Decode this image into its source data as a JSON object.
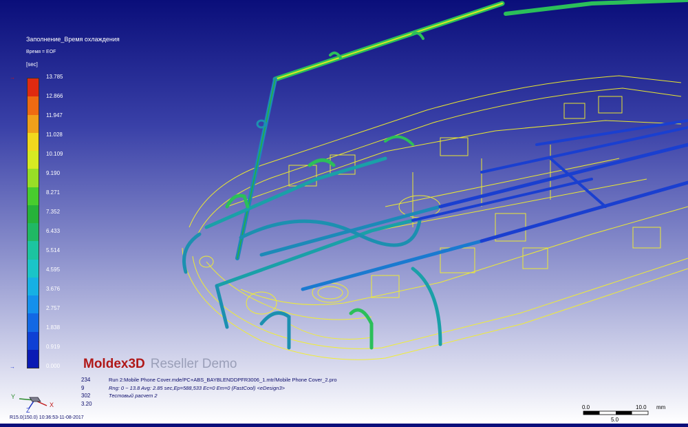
{
  "legend": {
    "title": "Заполнение_Время охлаждения",
    "time_label": "Время = EOF",
    "unit": "[sec]",
    "ticks": [
      "13.785",
      "12.866",
      "11.947",
      "11.028",
      "10.109",
      "9.190",
      "8.271",
      "7.352",
      "6.433",
      "5.514",
      "4.595",
      "3.676",
      "2.757",
      "1.838",
      "0.919",
      "0.000"
    ],
    "colors": [
      "#e02a10",
      "#ee6a12",
      "#f0a01a",
      "#f2d81e",
      "#d6ea22",
      "#98de26",
      "#48cc2e",
      "#26b23a",
      "#20b864",
      "#1cc4a0",
      "#1ac4c8",
      "#16b0e4",
      "#1490ec",
      "#1268e4",
      "#0e40d4",
      "#0a1ab4"
    ]
  },
  "brand": {
    "logo": "Moldex3D",
    "suffix": "Reseller Demo"
  },
  "stats": [
    "234",
    "9",
    "302",
    "3.20"
  ],
  "run": {
    "line1": "Run 2:Mobile Phone Cover.mde/PC+ABS_BAYBLENDDPFR3006_1.mtr/Mobile Phone Cover_2.pro",
    "line2": "Rng: 0 ~ 13.8  Avg: 2.85 sec,Ep=588,533 Ec=0 Em=0 (FastCool) <eDesign3>",
    "line3": "Тестовый расчет 2"
  },
  "version": "R15.0(150.0) 10:36:53-11-08-2017",
  "triad": {
    "y": "Y",
    "z": "Z",
    "x": "X"
  },
  "scale": {
    "t0": "0.0",
    "t1": "10.0",
    "unit": "mm",
    "mid": "5.0"
  },
  "colors": {
    "outline": "#f4f02a",
    "pipe_hot": "#2bbf5a",
    "pipe_cool": "#1a3fd0"
  }
}
